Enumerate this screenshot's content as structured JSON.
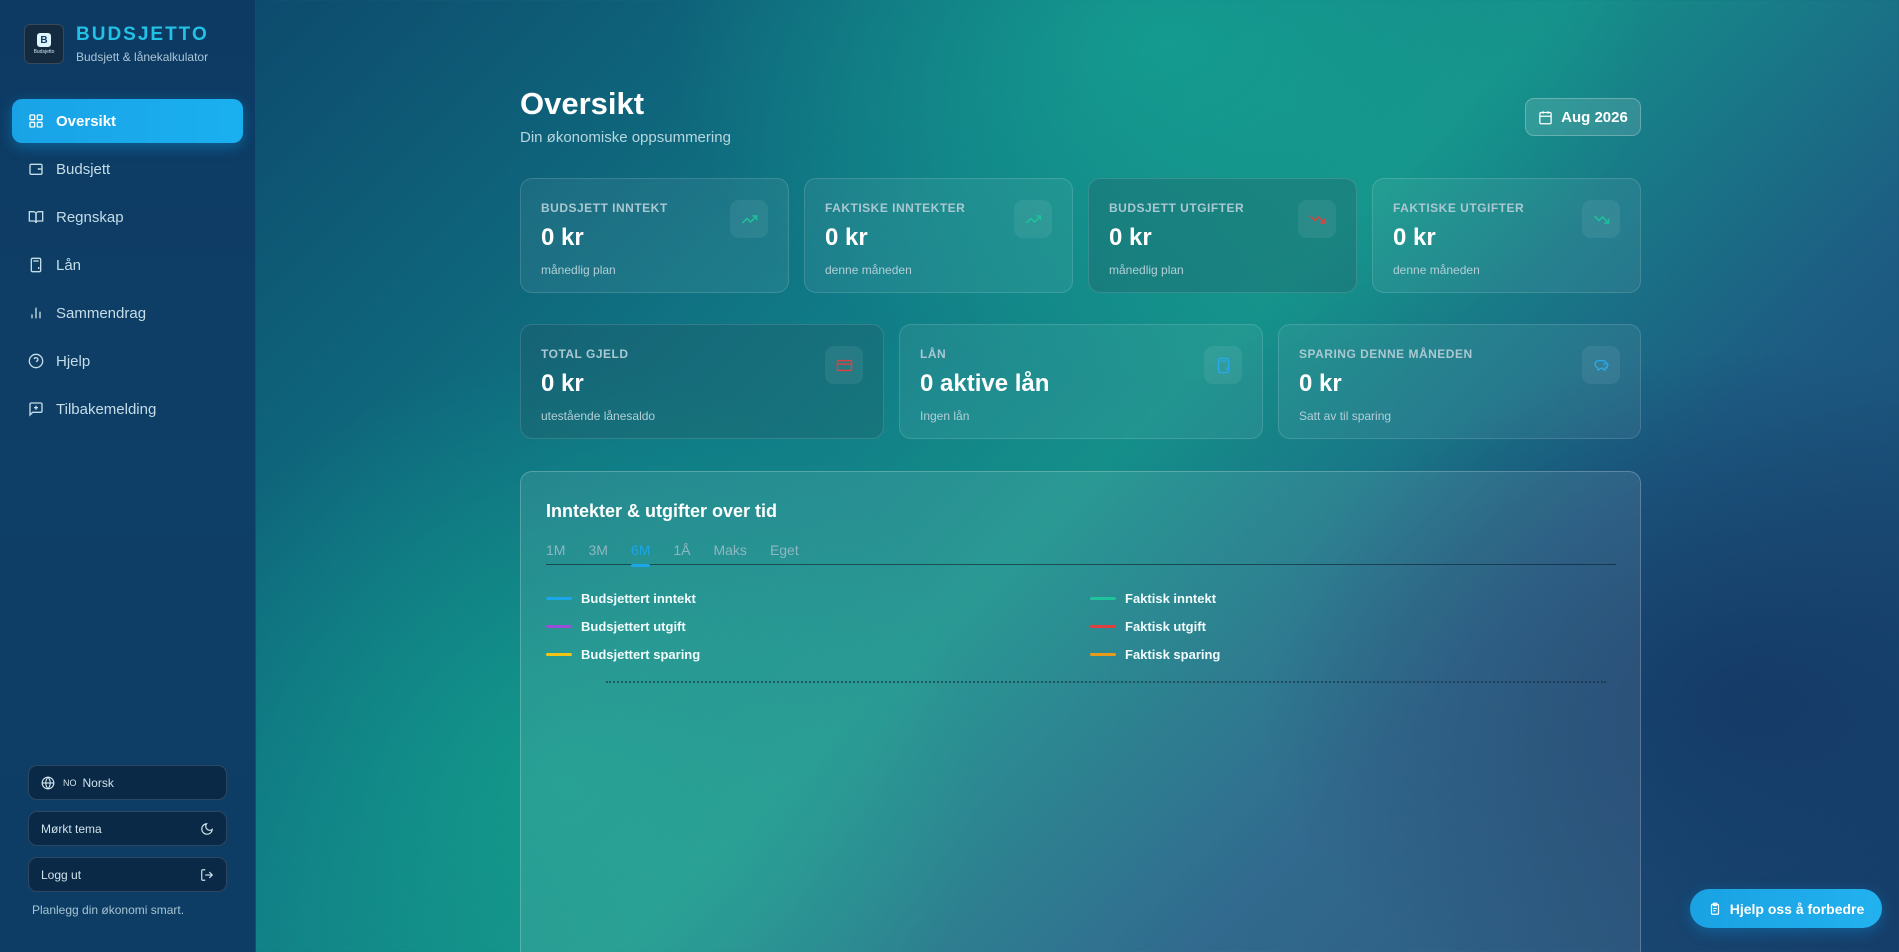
{
  "brand": {
    "name": "BUDSJETTO",
    "subtitle": "Budsjett & lånekalkulator",
    "logo_text": "Budsjetto"
  },
  "nav": {
    "items": [
      {
        "label": "Oversikt",
        "icon": "layout-grid-icon",
        "active": true
      },
      {
        "label": "Budsjett",
        "icon": "wallet-icon"
      },
      {
        "label": "Regnskap",
        "icon": "book-open-icon"
      },
      {
        "label": "Lån",
        "icon": "calculator-icon"
      },
      {
        "label": "Sammendrag",
        "icon": "bar-chart-icon"
      },
      {
        "label": "Hjelp",
        "icon": "help-circle-icon"
      },
      {
        "label": "Tilbakemelding",
        "icon": "message-square-icon"
      }
    ]
  },
  "sidebar_bottom": {
    "language_code": "NO",
    "language_label": "Norsk",
    "theme_label": "Mørkt tema",
    "logout_label": "Logg ut",
    "tagline": "Planlegg din økonomi smart."
  },
  "header": {
    "title": "Oversikt",
    "subtitle": "Din økonomiske oppsummering",
    "date_label": "Aug 2026"
  },
  "stats_row1": [
    {
      "label": "Budsjett inntekt",
      "value": "0 kr",
      "note": "månedlig plan",
      "icon": "trending-up-icon",
      "color": "#1fc29a"
    },
    {
      "label": "Faktiske inntekter",
      "value": "0 kr",
      "note": "denne måneden",
      "icon": "trending-up-icon",
      "color": "#1fc29a"
    },
    {
      "label": "Budsjett utgifter",
      "value": "0 kr",
      "note": "månedlig plan",
      "icon": "trending-down-icon",
      "color": "#e0413f"
    },
    {
      "label": "Faktiske utgifter",
      "value": "0 kr",
      "note": "denne måneden",
      "icon": "trending-down-icon",
      "color": "#1fc29a"
    }
  ],
  "stats_row2": [
    {
      "label": "Total gjeld",
      "value": "0 kr",
      "note": "utestående lånesaldo",
      "icon": "credit-card-icon",
      "color": "#e0413f"
    },
    {
      "label": "Lån",
      "value": "0 aktive lån",
      "note": "Ingen lån",
      "icon": "calculator-icon",
      "color": "#2aa8e8"
    },
    {
      "label": "Sparing denne måneden",
      "value": "0 kr",
      "note": "Satt av til sparing",
      "icon": "piggy-bank-icon",
      "color": "#2aa8e8"
    }
  ],
  "chart": {
    "title": "Inntekter & utgifter over tid",
    "tabs": [
      "1M",
      "3M",
      "6M",
      "1Å",
      "Maks",
      "Eget"
    ],
    "active_tab": "6M",
    "legend": [
      {
        "name": "Budsjettert inntekt",
        "color": "#1aa6e8"
      },
      {
        "name": "Faktisk inntekt",
        "color": "#1fc29a"
      },
      {
        "name": "Budsjettert utgift",
        "color": "#9b4fd8"
      },
      {
        "name": "Faktisk utgift",
        "color": "#e0413f"
      },
      {
        "name": "Budsjettert sparing",
        "color": "#f2c418"
      },
      {
        "name": "Faktisk sparing",
        "color": "#e89a1a"
      }
    ]
  },
  "help_button": {
    "label": "Hjelp oss å forbedre"
  }
}
